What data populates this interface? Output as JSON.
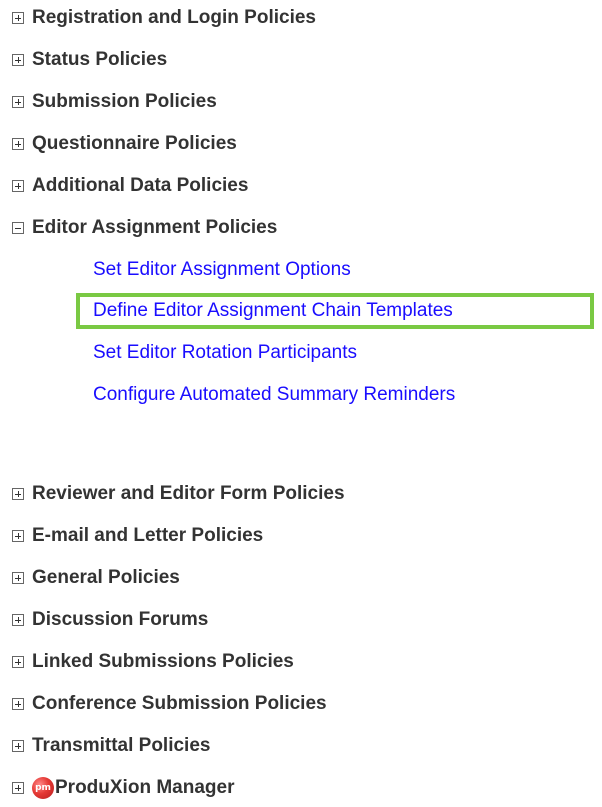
{
  "sections": [
    {
      "label": "Registration and Login Policies",
      "expanded": false
    },
    {
      "label": "Status Policies",
      "expanded": false
    },
    {
      "label": "Submission Policies",
      "expanded": false
    },
    {
      "label": "Questionnaire Policies",
      "expanded": false
    },
    {
      "label": "Additional Data Policies",
      "expanded": false
    },
    {
      "label": "Editor Assignment Policies",
      "expanded": true,
      "links": [
        "Set Editor Assignment Options",
        "Define Editor Assignment Chain Templates",
        "Set Editor Rotation Participants",
        "Configure Automated Summary Reminders"
      ]
    },
    {
      "label": "Reviewer and Editor Form Policies",
      "expanded": false
    },
    {
      "label": "E-mail and Letter Policies",
      "expanded": false
    },
    {
      "label": "General Policies",
      "expanded": false
    },
    {
      "label": "Discussion Forums",
      "expanded": false
    },
    {
      "label": "Linked Submissions Policies",
      "expanded": false
    },
    {
      "label": "Conference Submission Policies",
      "expanded": false
    },
    {
      "label": "Transmittal Policies",
      "expanded": false
    },
    {
      "label": "ProduXion Manager",
      "expanded": false,
      "logo_text": "pm",
      "logo_icon": "produxion-manager-logo-icon"
    }
  ],
  "highlighted_link": "Define Editor Assignment Chain Templates",
  "colors": {
    "section_text": "#333333",
    "link_text": "#1a0dff",
    "highlight_border": "#7ac943"
  }
}
